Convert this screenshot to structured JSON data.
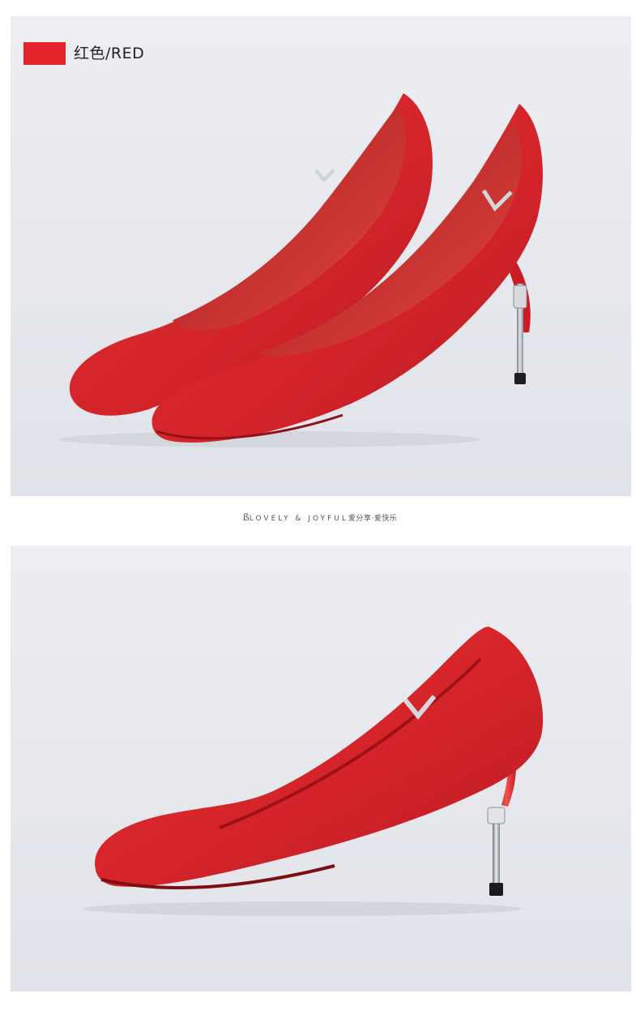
{
  "color_tag": {
    "swatch_color": "#e3242b",
    "label": "红色/RED"
  },
  "tagline": {
    "logo_letter": "ß",
    "english": "LOVELY & JOYFUL",
    "chinese": "爱分享·爱快乐"
  },
  "colors": {
    "suede_red": "#d8262a",
    "panel_bg": "#e7e9ee",
    "heel_metal": "#b9bcc2"
  }
}
